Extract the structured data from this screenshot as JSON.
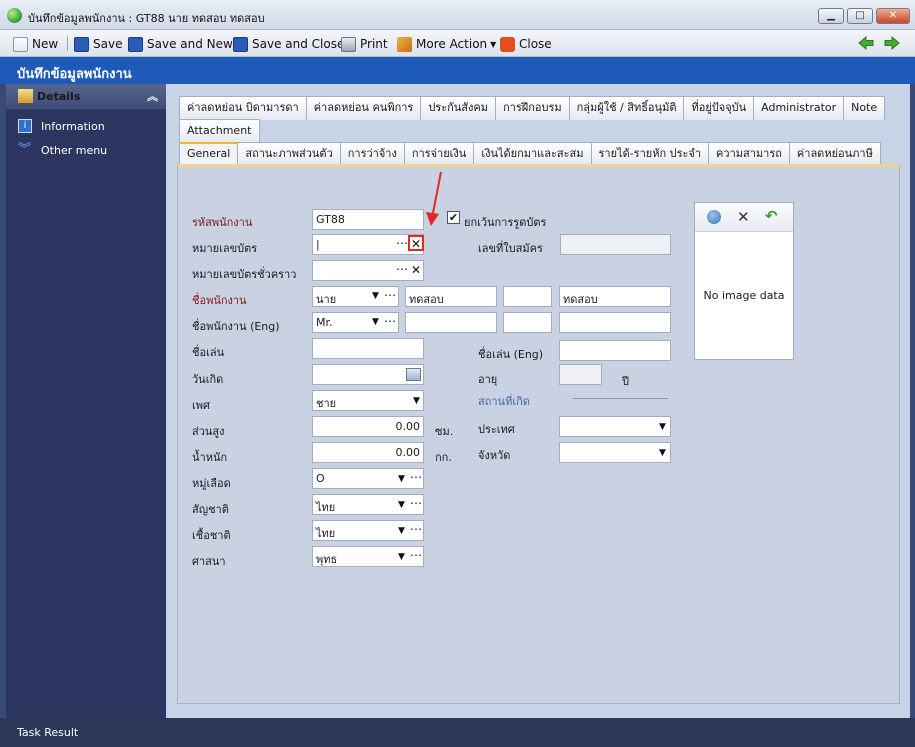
{
  "window": {
    "title": "บันทึกข้อมูลพนักงาน : GT88 นาย ทดสอบ ทดสอบ"
  },
  "toolbar": {
    "new": "New",
    "save": "Save",
    "save_and_new": "Save and New",
    "save_and_close": "Save and Close",
    "print": "Print",
    "more_action": "More Action",
    "close": "Close"
  },
  "page": {
    "title": "บันทึกข้อมูลพนักงาน"
  },
  "sidebar": {
    "header": "Details",
    "items": [
      {
        "label": "Information",
        "icon": "info-icon"
      },
      {
        "label": "Other menu",
        "icon": "double-chevron-down-icon"
      }
    ]
  },
  "tabs": {
    "row1": [
      "ค่าลดหย่อน บิดามารดา",
      "ค่าลดหย่อน คนพิการ",
      "ประกันสังคม",
      "การฝึกอบรม",
      "กลุ่มผู้ใช้ / สิทธิ์อนุมัติ",
      "ที่อยู่ปัจจุบัน",
      "Administrator",
      "Note"
    ],
    "row2": [
      "Attachment"
    ],
    "row3": [
      "General",
      "สถานะภาพส่วนตัว",
      "การว่าจ้าง",
      "การจ่ายเงิน",
      "เงินได้ยกมาและสะสม",
      "รายได้-รายหัก ประจำ",
      "ความสามารถ",
      "ค่าลดหย่อนภาษี"
    ],
    "active": "General"
  },
  "form": {
    "employee_code_label": "รหัสพนักงาน",
    "employee_code": "GT88",
    "exempt_card_label": "ยกเว้นการรูดบัตร",
    "exempt_card_checked": true,
    "card_no_label": "หมายเลขบัตร",
    "card_no": "|",
    "application_no_label": "เลขที่ใบสมัคร",
    "application_no": "",
    "temp_card_label": "หมายเลขบัตรชั่วคราว",
    "temp_card": "",
    "name_label": "ชื่อพนักงาน",
    "name_prefix": "นาย",
    "first_name": "ทดสอบ",
    "middle_name": "",
    "last_name": "ทดสอบ",
    "name_eng_label": "ชื่อพนักงาน (Eng)",
    "name_eng_prefix": "Mr.",
    "first_name_eng": "",
    "middle_name_eng": "",
    "last_name_eng": "",
    "nickname_label": "ชื่อเล่น",
    "nickname": "",
    "nickname_eng_label": "ชื่อเล่น (Eng)",
    "nickname_eng": "",
    "birthdate_label": "วันเกิด",
    "birthdate": "",
    "age_label": "อายุ",
    "age": "",
    "age_unit": "ปี",
    "gender_label": "เพศ",
    "gender": "ชาย",
    "birthplace_label": "สถานที่เกิด",
    "height_label": "ส่วนสูง",
    "height": "0.00",
    "height_unit": "ซม.",
    "country_label": "ประเทศ",
    "country": "",
    "weight_label": "น้ำหนัก",
    "weight": "0.00",
    "weight_unit": "กก.",
    "province_label": "จังหวัด",
    "province": "",
    "blood_label": "หมู่เลือด",
    "blood": "O",
    "nationality_label": "สัญชาติ",
    "nationality": "ไทย",
    "race_label": "เชื้อชาติ",
    "race": "ไทย",
    "religion_label": "ศาสนา",
    "religion": "พุทธ"
  },
  "photo": {
    "empty_text": "No image data"
  },
  "status": {
    "text": "Task Result"
  },
  "colors": {
    "page_bar": "#1e5bb8",
    "sidebar": "#2d3660",
    "annotation": "#e32727"
  }
}
